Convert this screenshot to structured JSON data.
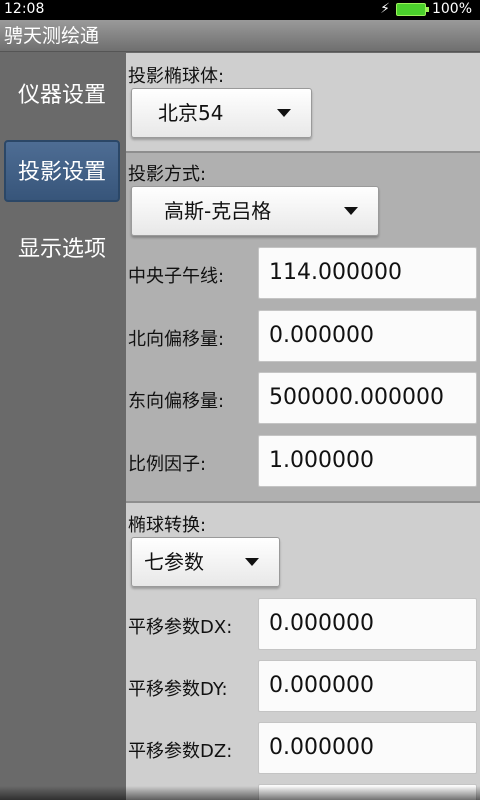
{
  "status": {
    "time": "12:08",
    "battery": "100%"
  },
  "app": {
    "title": "骋天测绘通"
  },
  "sidebar": {
    "items": [
      {
        "label": "仪器设置"
      },
      {
        "label": "投影设置"
      },
      {
        "label": "显示选项"
      }
    ]
  },
  "ellipsoid": {
    "label": "投影椭球体:",
    "value": "北京54"
  },
  "projection": {
    "label": "投影方式:",
    "method": "高斯-克吕格",
    "fields": [
      {
        "label": "中央子午线:",
        "value": "114.000000"
      },
      {
        "label": "北向偏移量:",
        "value": "0.000000"
      },
      {
        "label": "东向偏移量:",
        "value": "500000.000000"
      },
      {
        "label": "比例因子:",
        "value": "1.000000"
      }
    ]
  },
  "transform": {
    "label": "椭球转换:",
    "method": "七参数",
    "fields": [
      {
        "label": "平移参数DX:",
        "value": "0.000000"
      },
      {
        "label": "平移参数DY:",
        "value": "0.000000"
      },
      {
        "label": "平移参数DZ:",
        "value": "0.000000"
      }
    ]
  }
}
